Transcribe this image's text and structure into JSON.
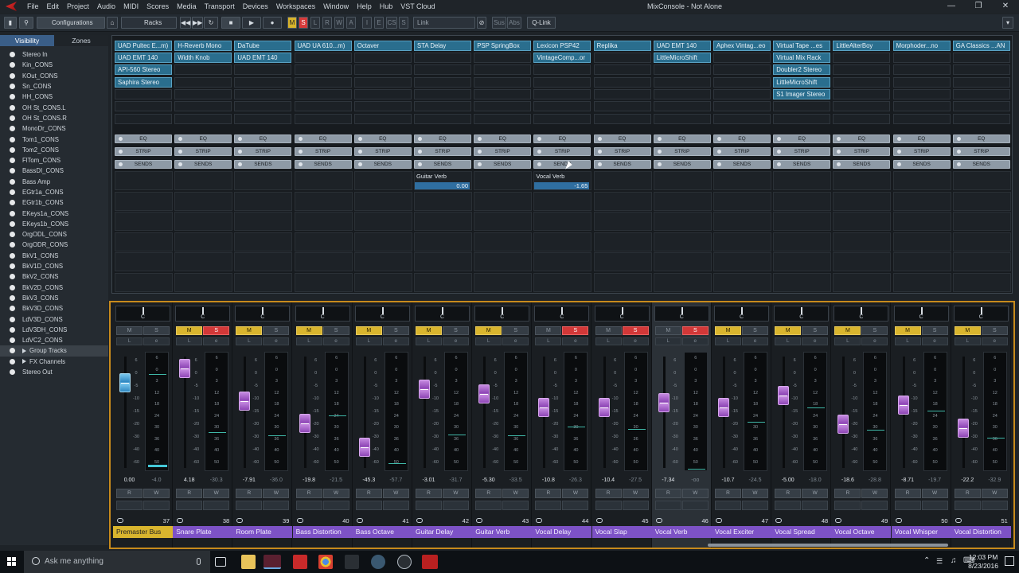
{
  "window": {
    "title": "MixConsole - Not Alone"
  },
  "menu": [
    "File",
    "Edit",
    "Project",
    "Audio",
    "MIDI",
    "Scores",
    "Media",
    "Transport",
    "Devices",
    "Workspaces",
    "Window",
    "Help",
    "Hub",
    "VST Cloud"
  ],
  "toolbar": {
    "configurations": "Configurations",
    "racks": "Racks",
    "link": "Link",
    "sus": "Sus",
    "abs": "Abs",
    "qlink": "Q-Link",
    "m": "M",
    "s": "S",
    "l": "L",
    "r": "R",
    "w": "W",
    "a": "A",
    "i": "I",
    "e": "E",
    "cs": "CS",
    "s2": "S"
  },
  "left_panel": {
    "tabs": [
      "Visibility",
      "Zones"
    ],
    "items": [
      "Stereo In",
      "Kin_CONS",
      "KOut_CONS",
      "Sn_CONS",
      "HH_CONS",
      "OH St_CONS.L",
      "OH St_CONS.R",
      "MonoDr_CONS",
      "Tom1_CONS",
      "Tom2_CONS",
      "FlTom_CONS",
      "BassDI_CONS",
      "Bass Amp",
      "EGtr1a_CONS",
      "EGtr1b_CONS",
      "EKeys1a_CONS",
      "EKeys1b_CONS",
      "OrgODL_CONS",
      "OrgODR_CONS",
      "BkV1_CONS",
      "BkV1D_CONS",
      "BkV2_CONS",
      "BkV2D_CONS",
      "BkV3_CONS",
      "BkV3D_CONS",
      "LdV3D_CONS",
      "LdV3DH_CONS",
      "LdVC2_CONS",
      "Group Tracks",
      "FX Channels",
      "Stereo Out"
    ]
  },
  "sections": {
    "eq": "EQ",
    "strip": "STRIP",
    "sends": "SENDS"
  },
  "inserts": [
    [
      "UAD Pultec E...m)",
      "UAD EMT 140",
      "API-560 Stereo",
      "Saphira Stereo"
    ],
    [
      "H-Reverb Mono",
      "Width Knob"
    ],
    [
      "DaTube",
      "UAD EMT 140"
    ],
    [
      "UAD UA 610...m)"
    ],
    [
      "Octaver"
    ],
    [
      "STA Delay"
    ],
    [
      "PSP SpringBox"
    ],
    [
      "Lexicon PSP42",
      "VintageComp...or"
    ],
    [
      "Replika"
    ],
    [
      "UAD EMT 140",
      "LittleMicroShift"
    ],
    [
      "Aphex Vintag...eo"
    ],
    [
      "Virtual Tape ...es",
      "Virtual Mix Rack",
      "Doubler2 Stereo",
      "LittleMicroShift",
      "S1 Imager Stereo"
    ],
    [
      "LittleAlterBoy"
    ],
    [
      "Morphoder...no"
    ],
    [
      "GA Classics ...AN"
    ]
  ],
  "sends": [
    {
      "channel_index": 5,
      "name": "Guitar Verb",
      "value": "0.00"
    },
    {
      "channel_index": 7,
      "name": "Vocal Verb",
      "value": "-1.65"
    }
  ],
  "fader_scale": [
    "6",
    "0",
    "-5",
    "-10",
    "-15",
    "-20",
    "-30",
    "-40",
    "-60"
  ],
  "meter_scale": [
    "6",
    "0",
    "3",
    "12",
    "18",
    "24",
    "30",
    "36",
    "40",
    "50"
  ],
  "channels": [
    {
      "number": "37",
      "name": "Premaster Bus",
      "volume": "0.00",
      "peak": "-4.0",
      "fader_level": 0.82,
      "meter_level": 0.85,
      "mute": false,
      "solo": false,
      "color": "gold"
    },
    {
      "number": "38",
      "name": "Snare Plate",
      "volume": "4.18",
      "peak": "-30.3",
      "fader_level": 0.97,
      "meter_level": 0.33,
      "mute": true,
      "solo": true,
      "color": "purple"
    },
    {
      "number": "39",
      "name": "Room Plate",
      "volume": "-7.91",
      "peak": "-36.0",
      "fader_level": 0.62,
      "meter_level": 0.3,
      "mute": true,
      "solo": false,
      "color": "purple"
    },
    {
      "number": "40",
      "name": "Bass Distortion",
      "volume": "-19.8",
      "peak": "-21.5",
      "fader_level": 0.38,
      "meter_level": 0.48,
      "mute": true,
      "solo": false,
      "color": "purple"
    },
    {
      "number": "41",
      "name": "Bass Octave",
      "volume": "-45.3",
      "peak": "-57.7",
      "fader_level": 0.12,
      "meter_level": 0.05,
      "mute": true,
      "solo": false,
      "color": "purple"
    },
    {
      "number": "42",
      "name": "Guitar Delay",
      "volume": "-3.01",
      "peak": "-31.7",
      "fader_level": 0.75,
      "meter_level": 0.31,
      "mute": true,
      "solo": false,
      "color": "purple"
    },
    {
      "number": "43",
      "name": "Guitar Verb",
      "volume": "-5.30",
      "peak": "-33.5",
      "fader_level": 0.7,
      "meter_level": 0.3,
      "mute": true,
      "solo": false,
      "color": "purple"
    },
    {
      "number": "44",
      "name": "Vocal Delay",
      "volume": "-10.8",
      "peak": "-26.3",
      "fader_level": 0.55,
      "meter_level": 0.38,
      "mute": false,
      "solo": true,
      "color": "purple"
    },
    {
      "number": "45",
      "name": "Vocal Slap",
      "volume": "-10.4",
      "peak": "-27.5",
      "fader_level": 0.55,
      "meter_level": 0.36,
      "mute": false,
      "solo": true,
      "color": "purple"
    },
    {
      "number": "46",
      "name": "Vocal Verb",
      "volume": "-7.34",
      "peak": "-oo",
      "fader_level": 0.6,
      "meter_level": 0.0,
      "mute": false,
      "solo": true,
      "color": "purple"
    },
    {
      "number": "47",
      "name": "Vocal Exciter",
      "volume": "-10.7",
      "peak": "-24.5",
      "fader_level": 0.55,
      "meter_level": 0.42,
      "mute": true,
      "solo": false,
      "color": "purple"
    },
    {
      "number": "48",
      "name": "Vocal  Spread",
      "volume": "-5.00",
      "peak": "-18.0",
      "fader_level": 0.68,
      "meter_level": 0.55,
      "mute": true,
      "solo": false,
      "color": "purple"
    },
    {
      "number": "49",
      "name": "Vocal Octave",
      "volume": "-18.6",
      "peak": "-28.8",
      "fader_level": 0.37,
      "meter_level": 0.35,
      "mute": true,
      "solo": false,
      "color": "purple"
    },
    {
      "number": "50",
      "name": "Vocal Whisper",
      "volume": "-8.71",
      "peak": "-19.7",
      "fader_level": 0.58,
      "meter_level": 0.52,
      "mute": true,
      "solo": false,
      "color": "purple"
    },
    {
      "number": "51",
      "name": "Vocal Distortion",
      "volume": "-22.2",
      "peak": "-32.9",
      "fader_level": 0.33,
      "meter_level": 0.28,
      "mute": true,
      "solo": false,
      "color": "purple"
    }
  ],
  "taskbar": {
    "search_placeholder": "Ask me anything",
    "time": "12:03 PM",
    "date": "8/23/2016"
  }
}
